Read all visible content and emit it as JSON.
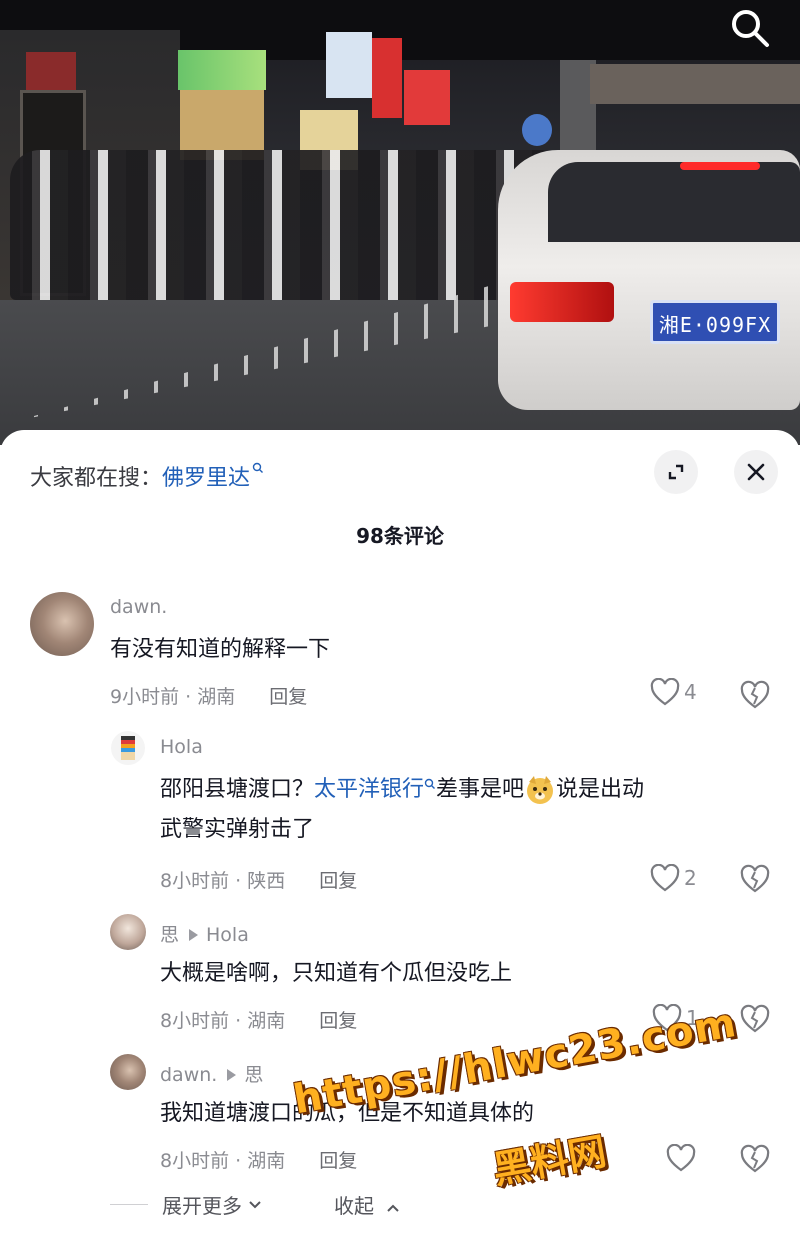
{
  "video": {
    "plate_text": "湘E·099FX"
  },
  "header": {
    "hot_search_label": "大家都在搜：",
    "hot_search_term": "佛罗里达",
    "comment_count": "98条评论"
  },
  "comments": [
    {
      "user": "dawn.",
      "text": "有没有知道的解释一下",
      "meta": "9小时前 · 湖南",
      "reply_label": "回复",
      "likes": "4"
    },
    {
      "user": "Hola",
      "text_part1": "邵阳县塘渡口？",
      "link": "太平洋银行",
      "text_part2": "差事是吧",
      "text_part3": "说是出动",
      "text_line2": "武警实弹射击了",
      "meta": "8小时前 · 陕西",
      "reply_label": "回复",
      "likes": "2"
    },
    {
      "user": "思",
      "reply_to": "Hola",
      "text": "大概是啥啊，只知道有个瓜但没吃上",
      "meta": "8小时前 · 湖南",
      "reply_label": "回复",
      "likes": "1"
    },
    {
      "user": "dawn.",
      "reply_to": "思",
      "text": "我知道塘渡口的瓜，但是不知道具体的",
      "meta": "8小时前 · 湖南",
      "reply_label": "回复",
      "likes": ""
    }
  ],
  "footer": {
    "expand_more": "展开更多",
    "collapse": "收起"
  },
  "watermark": {
    "url": "https://hlwc23.com",
    "name": "黑料网"
  }
}
